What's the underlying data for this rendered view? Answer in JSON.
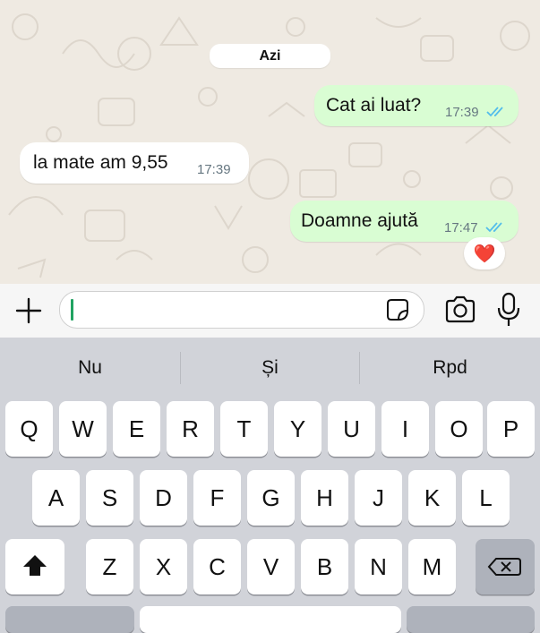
{
  "chat": {
    "date_label": "Azi",
    "messages": [
      {
        "direction": "outgoing",
        "text": "Cat ai luat?",
        "time": "17:39",
        "status": "read"
      },
      {
        "direction": "incoming",
        "text": "la mate am 9,55",
        "time": "17:39"
      },
      {
        "direction": "outgoing",
        "text": "Doamne ajută",
        "time": "17:47",
        "status": "read"
      }
    ],
    "reaction": "❤️",
    "tick_color": "#53bdeb",
    "outgoing_bubble_color": "#d9fdd3"
  },
  "composer": {
    "input_value": "",
    "icons": [
      "plus-icon",
      "sticker-icon",
      "camera-icon",
      "microphone-icon"
    ],
    "cursor_color": "#21a362"
  },
  "keyboard": {
    "suggestions": [
      "Nu",
      "Și",
      "Rpd"
    ],
    "row1": [
      "Q",
      "W",
      "E",
      "R",
      "T",
      "Y",
      "U",
      "I",
      "O",
      "P"
    ],
    "row2": [
      "A",
      "S",
      "D",
      "F",
      "G",
      "H",
      "J",
      "K",
      "L"
    ],
    "row3": [
      "Z",
      "X",
      "C",
      "V",
      "B",
      "N",
      "M"
    ],
    "shift_icon": "shift-icon",
    "delete_icon": "backspace-icon"
  }
}
